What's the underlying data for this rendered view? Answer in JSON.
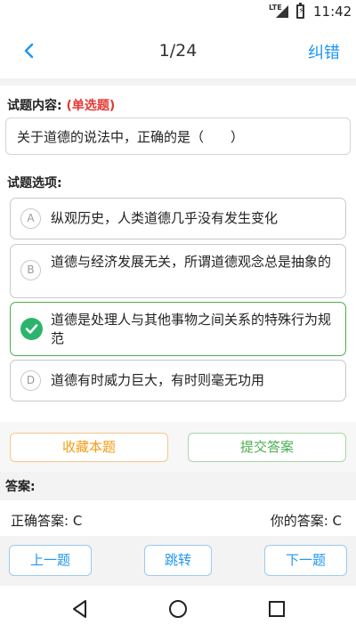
{
  "status_bar": {
    "network": "LTE",
    "time": "11:42"
  },
  "header": {
    "progress": "1/24",
    "correct_label": "纠错"
  },
  "question": {
    "content_label": "试题内容:",
    "type_label": "(单选题)",
    "text": "关于道德的说法中，正确的是（　　）",
    "options_label": "试题选项:"
  },
  "options": [
    {
      "letter": "A",
      "text": "纵观历史，人类道德几乎没有发生变化",
      "selected": false
    },
    {
      "letter": "B",
      "text": "道德与经济发展无关，所谓道德观念总是抽象的",
      "selected": false
    },
    {
      "letter": "C",
      "text": "道德是处理人与其他事物之间关系的特殊行为规范",
      "selected": true
    },
    {
      "letter": "D",
      "text": "道德有时威力巨大，有时则毫无功用",
      "selected": false
    }
  ],
  "actions": {
    "favorite_label": "收藏本题",
    "submit_label": "提交答案"
  },
  "answer": {
    "title": "答案:",
    "correct_answer": "正确答案: C",
    "your_answer": "你的答案: C"
  },
  "navigation": {
    "prev_label": "上一题",
    "jump_label": "跳转",
    "next_label": "下一题"
  },
  "colors": {
    "accent": "#2196f3",
    "selected": "#4caf50",
    "check": "#2bb56c",
    "type_label": "#e53935",
    "favorite": "#f39c12"
  },
  "icons": {
    "back": "chevron-left-icon",
    "check": "check-circle-icon",
    "sys_back": "triangle-back-icon",
    "sys_home": "circle-home-icon",
    "sys_recent": "square-recent-icon"
  }
}
